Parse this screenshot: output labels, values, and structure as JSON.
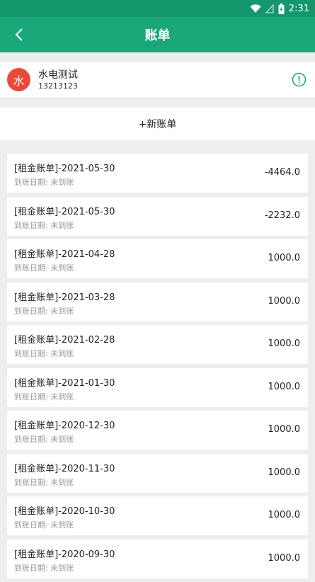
{
  "status_bar": {
    "time": "2:31"
  },
  "app_bar": {
    "title": "账单"
  },
  "user": {
    "avatar_text": "水",
    "name": "水电测试",
    "phone": "13213123"
  },
  "new_bill": {
    "label": "+新账单"
  },
  "bills": [
    {
      "title": "[租金账单]-2021-05-30",
      "subtitle": "到账日期: 未到账",
      "amount": "-4464.0"
    },
    {
      "title": "[租金账单]-2021-05-30",
      "subtitle": "到账日期: 未到账",
      "amount": "-2232.0"
    },
    {
      "title": "[租金账单]-2021-04-28",
      "subtitle": "到账日期: 未到账",
      "amount": "1000.0"
    },
    {
      "title": "[租金账单]-2021-03-28",
      "subtitle": "到账日期: 未到账",
      "amount": "1000.0"
    },
    {
      "title": "[租金账单]-2021-02-28",
      "subtitle": "到账日期: 未到账",
      "amount": "1000.0"
    },
    {
      "title": "[租金账单]-2021-01-30",
      "subtitle": "到账日期: 未到账",
      "amount": "1000.0"
    },
    {
      "title": "[租金账单]-2020-12-30",
      "subtitle": "到账日期: 未到账",
      "amount": "1000.0"
    },
    {
      "title": "[租金账单]-2020-11-30",
      "subtitle": "到账日期: 未到账",
      "amount": "1000.0"
    },
    {
      "title": "[租金账单]-2020-10-30",
      "subtitle": "到账日期: 未到账",
      "amount": "1000.0"
    },
    {
      "title": "[租金账单]-2020-09-30",
      "subtitle": "到账日期: 未到账",
      "amount": "1000.0"
    }
  ],
  "colors": {
    "header": "#1aa77a",
    "avatar": "#e64a3b",
    "info": "#1aa77a"
  },
  "icons": {
    "back": "back-arrow-icon",
    "info": "info-circle-icon",
    "wifi": "wifi-icon",
    "signal": "signal-icon",
    "battery": "battery-icon"
  }
}
